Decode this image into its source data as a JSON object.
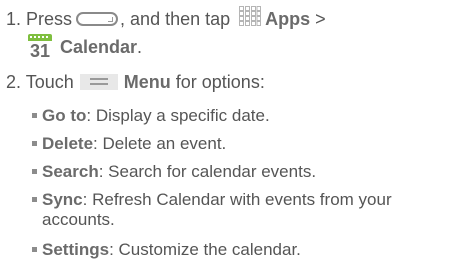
{
  "step1": {
    "number": "1.",
    "press": "Press",
    "then_tap": ", and then tap",
    "apps": "Apps",
    "gt": ">",
    "calendar_day": "31",
    "calendar": "Calendar",
    "period": "."
  },
  "step2": {
    "number": "2.",
    "touch": "Touch",
    "menu": "Menu",
    "for_options": "for options:"
  },
  "options": [
    {
      "label": "Go to",
      "desc": ": Display a specific date."
    },
    {
      "label": "Delete",
      "desc": ": Delete an event."
    },
    {
      "label": "Search",
      "desc": ": Search for calendar events."
    },
    {
      "label": "Sync",
      "desc": ": Refresh Calendar with events from your",
      "desc2": "accounts."
    },
    {
      "label": "Settings",
      "desc": ": Customize the calendar."
    }
  ],
  "icons": {
    "home": "home-key-icon",
    "apps": "apps-grid-icon",
    "calendar": "calendar-icon",
    "menu": "menu-key-icon",
    "calendar_color": "#7fbf3f"
  }
}
